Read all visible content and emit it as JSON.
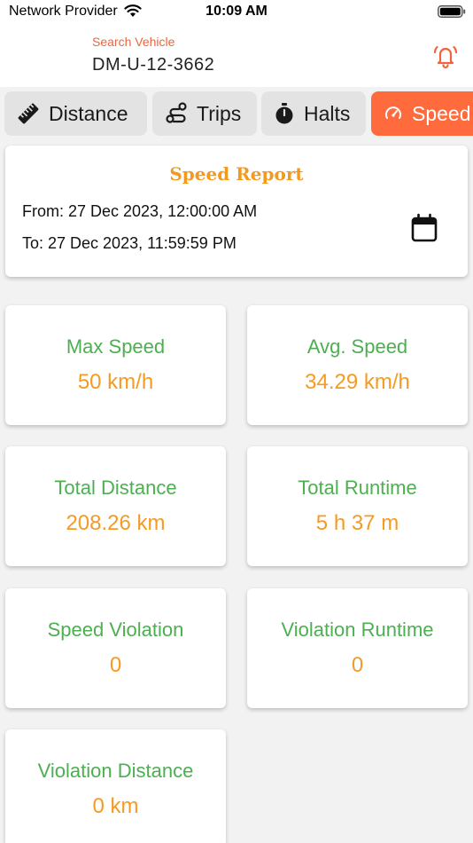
{
  "status_bar": {
    "carrier": "Network Provider",
    "time": "10:09 AM"
  },
  "header": {
    "search_label": "Search Vehicle",
    "vehicle_id": "DM-U-12-3662"
  },
  "tabs": [
    {
      "label": "Distance",
      "icon": "ruler-icon"
    },
    {
      "label": "Trips",
      "icon": "route-icon"
    },
    {
      "label": "Halts",
      "icon": "stopwatch-icon"
    },
    {
      "label": "Speed",
      "icon": "speedometer-icon",
      "active": true
    }
  ],
  "report": {
    "title": "Speed Report",
    "from": "From: 27 Dec 2023, 12:00:00 AM",
    "to": "To: 27 Dec 2023, 11:59:59 PM"
  },
  "stats": [
    {
      "label": "Max Speed",
      "value": "50 km/h"
    },
    {
      "label": "Avg. Speed",
      "value": "34.29 km/h"
    },
    {
      "label": "Total Distance",
      "value": "208.26 km"
    },
    {
      "label": "Total Runtime",
      "value": "5 h 37 m"
    },
    {
      "label": "Speed Violation",
      "value": "0"
    },
    {
      "label": "Violation Runtime",
      "value": "0"
    },
    {
      "label": "Violation Distance",
      "value": "0 km"
    }
  ],
  "colors": {
    "accent": "#ff6b3d",
    "label_green": "#4caf50",
    "value_orange": "#f59a23",
    "title_orange": "#f39a1e"
  }
}
